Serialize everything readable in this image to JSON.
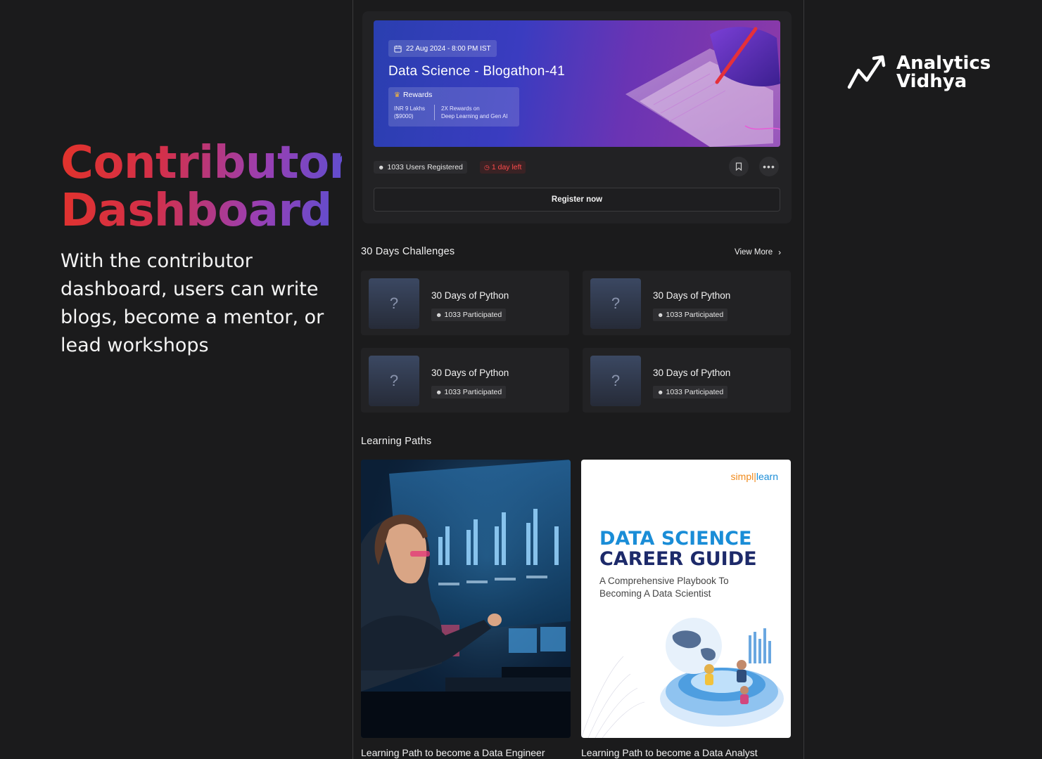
{
  "hero": {
    "title_line1": "Contributor",
    "title_line2": "Dashboard",
    "description": "With the contributor dashboard, users can write blogs, become a mentor, or lead workshops"
  },
  "brand": {
    "name_line1": "Analytics",
    "name_line2": "Vidhya"
  },
  "event": {
    "date": "22 Aug 2024 - 8:00 PM IST",
    "title": "Data Science - Blogathon-41",
    "rewards_label": "Rewards",
    "reward1_line1": "INR 9 Lakhs",
    "reward1_line2": "($9000)",
    "reward2_line1": "2X Rewards on",
    "reward2_line2": "Deep Learning and Gen AI",
    "users_registered": "1033 Users Registered",
    "time_left": "1 day left",
    "register_label": "Register now"
  },
  "challenges": {
    "section_title": "30 Days Challenges",
    "view_more_label": "View More",
    "items": [
      {
        "title": "30 Days of Python",
        "participants": "1033 Participated"
      },
      {
        "title": "30 Days of Python",
        "participants": "1033 Participated"
      },
      {
        "title": "30 Days of Python",
        "participants": "1033 Participated"
      },
      {
        "title": "30 Days of Python",
        "participants": "1033 Participated"
      }
    ]
  },
  "learning_paths": {
    "section_title": "Learning Paths",
    "items": [
      {
        "caption": "Learning Path to become a Data Engineer"
      },
      {
        "caption": "Learning Path to become a Data Analyst",
        "logo_part1": "simpl",
        "logo_part2": "learn",
        "cover_title_line1": "DATA SCIENCE",
        "cover_title_line2": "CAREER GUIDE",
        "cover_subtitle": "A Comprehensive Playbook To Becoming A Data Scientist"
      }
    ]
  },
  "colors": {
    "background": "#1b1b1c",
    "card": "#222224",
    "accent_red": "#e2332b",
    "accent_purple": "#5a4fd2",
    "danger": "#ff4b4b"
  },
  "icons": {
    "date": "calendar-icon",
    "rewards": "trophy-icon",
    "users": "user-icon",
    "timer": "clock-icon",
    "bookmark": "bookmark-icon",
    "more": "ellipsis-icon",
    "view_more": "chevron-right-icon",
    "challenge_thumb": "question-mark-icon"
  }
}
